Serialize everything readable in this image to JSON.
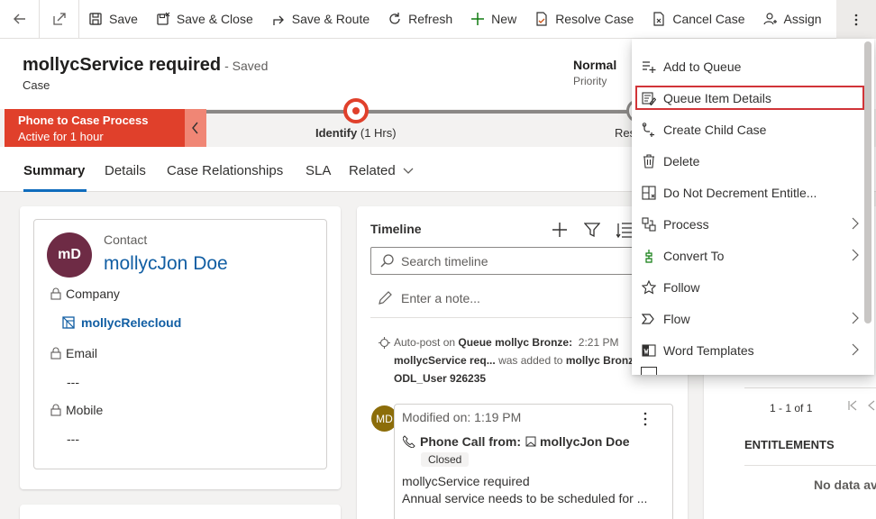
{
  "toolbar": {
    "items": [
      {
        "label": "Save",
        "icon": "save-icon"
      },
      {
        "label": "Save & Close",
        "icon": "save-close-icon"
      },
      {
        "label": "Save & Route",
        "icon": "route-icon"
      },
      {
        "label": "Refresh",
        "icon": "refresh-icon"
      },
      {
        "label": "New",
        "icon": "plus-icon"
      },
      {
        "label": "Resolve Case",
        "icon": "resolve-icon"
      },
      {
        "label": "Cancel Case",
        "icon": "cancel-icon"
      },
      {
        "label": "Assign",
        "icon": "assign-icon"
      }
    ]
  },
  "header": {
    "title": "mollycService required",
    "saved": "- Saved",
    "entity": "Case",
    "priority_value": "Normal",
    "priority_label": "Priority"
  },
  "bpf": {
    "process_name": "Phone to Case Process",
    "process_status": "Active for 1 hour",
    "stage_active": "Identify",
    "stage_active_time": "(1 Hrs)",
    "stage_next": "Res"
  },
  "tabs": [
    "Summary",
    "Details",
    "Case Relationships",
    "SLA",
    "Related"
  ],
  "contact": {
    "avatar_initials": "mD",
    "label": "Contact",
    "name": "mollycJon Doe",
    "company_label": "Company",
    "company_value": "mollycRelecloud",
    "email_label": "Email",
    "email_value": "---",
    "mobile_label": "Mobile",
    "mobile_value": "---"
  },
  "timeline": {
    "title": "Timeline",
    "search_placeholder": "Search timeline",
    "note_placeholder": "Enter a note...",
    "autopost": {
      "prefix": "Auto-post on",
      "queue": "Queue mollyc Bronze:",
      "time": "2:21 PM",
      "line2_subject": "mollycService req...",
      "line2_text": "was added to",
      "line2_target": "mollyc Bronz",
      "line3": "ODL_User 926235"
    },
    "activity": {
      "avatar_initials": "MD",
      "modified": "Modified on: 1:19 PM",
      "from": "Phone Call from:",
      "from_name": "mollycJon Doe",
      "status": "Closed",
      "subject": "mollycService required",
      "description": "Annual service needs to be scheduled for ..."
    }
  },
  "right_panel": {
    "pager": "1 - 1 of 1",
    "entitlements": "ENTITLEMENTS",
    "no_data": "No data av"
  },
  "menu": {
    "items": [
      {
        "label": "Add to Queue",
        "icon": "add-queue-icon",
        "submenu": false
      },
      {
        "label": "Queue Item Details",
        "icon": "queue-details-icon",
        "submenu": false,
        "highlighted": true
      },
      {
        "label": "Create Child Case",
        "icon": "child-case-icon",
        "submenu": false
      },
      {
        "label": "Delete",
        "icon": "delete-icon",
        "submenu": false
      },
      {
        "label": "Do Not Decrement Entitle...",
        "icon": "entitlement-icon",
        "submenu": false
      },
      {
        "label": "Process",
        "icon": "process-icon",
        "submenu": true
      },
      {
        "label": "Convert To",
        "icon": "convert-icon",
        "submenu": true
      },
      {
        "label": "Follow",
        "icon": "star-icon",
        "submenu": false
      },
      {
        "label": "Flow",
        "icon": "flow-icon",
        "submenu": true
      },
      {
        "label": "Word Templates",
        "icon": "word-icon",
        "submenu": true
      }
    ]
  },
  "colors": {
    "accent": "#0f6cbd",
    "process_red": "#e0402b",
    "highlight": "#d13438"
  }
}
